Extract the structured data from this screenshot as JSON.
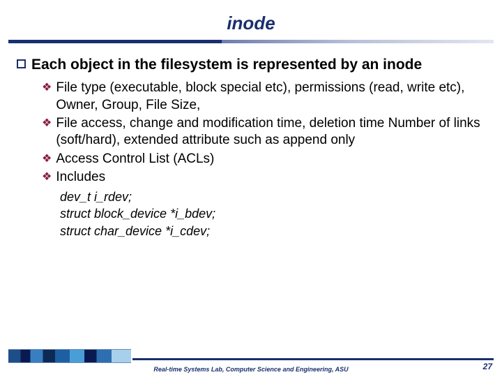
{
  "title": "inode",
  "main_point": "Each object in the filesystem is represented by an inode",
  "sub_points": [
    "File type (executable, block special etc), permissions (read, write etc), Owner, Group, File Size,",
    "File access, change and modification time, deletion time Number of links (soft/hard), extended attribute such as append only",
    "Access Control List (ACLs)",
    "Includes"
  ],
  "code_lines": [
    "dev_t i_rdev;",
    "struct block_device *i_bdev;",
    "struct char_device *i_cdev;"
  ],
  "footer": "Real-time Systems Lab, Computer Science and Engineering, ASU",
  "page_number": "27"
}
